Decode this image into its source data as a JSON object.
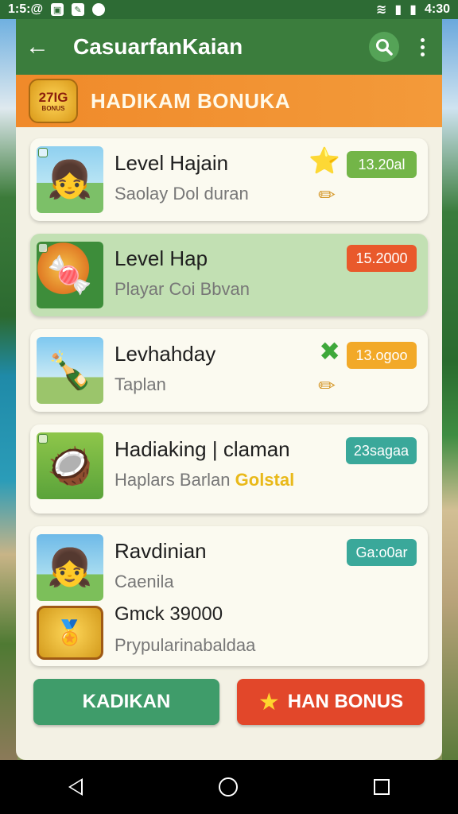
{
  "status": {
    "time_left": "1:5:@",
    "time_right": "4:30"
  },
  "appbar": {
    "title": "CasuarfanKaian",
    "back_icon": "arrow-left-icon",
    "search_icon": "search-icon",
    "menu_icon": "more-vert-icon"
  },
  "banner": {
    "badge_top": "27IG",
    "badge_bottom": "BONUS",
    "title": "HADIKAM BONUKA"
  },
  "cards": [
    {
      "title": "Level Hajain",
      "subtitle": "Saolay Dol duran",
      "price": "13.20al",
      "pill_color": "#73b548",
      "deco": "star-icon"
    },
    {
      "title": "Level Hap",
      "subtitle": "Playar Coi Bbvan",
      "price": "15.2000",
      "pill_color": "#e9592b"
    },
    {
      "title": "Levhahday",
      "subtitle": "Taplan",
      "price": "13.ogoo",
      "pill_color": "#f2a928",
      "deco": "leaf-icon"
    },
    {
      "title": "Hadiaking | claman",
      "subtitle_a": "Haplars Barlan ",
      "subtitle_b": "Golstal",
      "price": "23sagaa",
      "pill_color": "#3aa89a"
    },
    {
      "title": "Ravdinian",
      "subtitle": "Caenila",
      "extra": "Gmck 39000",
      "extra2": "Prypularinabaldaa",
      "price": "Ga:o0ar",
      "pill_color": "#3aa89a"
    }
  ],
  "buttons": {
    "left": "KADIKAN",
    "right": "HAN BONUS"
  }
}
